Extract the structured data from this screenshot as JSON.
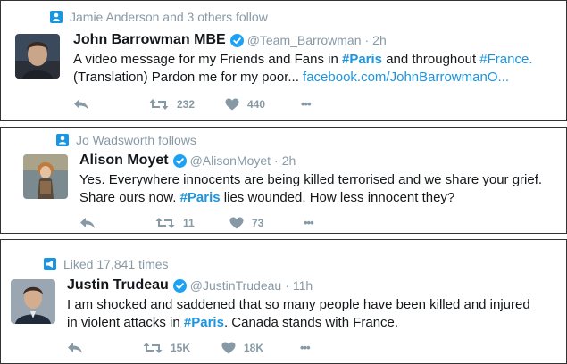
{
  "tweets": [
    {
      "context": "Jamie Anderson and 3 others follow",
      "name": "John Barrowman MBE",
      "handle": "@Team_Barrowman",
      "time": "2h",
      "line1": {
        "a": "A video message for my Friends and Fans in ",
        "b": "#Paris",
        "c": " and throughout ",
        "d": "#France."
      },
      "line2": {
        "a": "(Translation) Pardon me for my poor... ",
        "b": "facebook.com/JohnBarrowmanO..."
      },
      "retweets": "232",
      "likes": "440"
    },
    {
      "context": "Jo Wadsworth follows",
      "name": "Alison Moyet",
      "handle": "@AlisonMoyet",
      "time": "2h",
      "line1": "Yes. Everywhere innocents are being killed terrorised and we share your grief.",
      "line2": {
        "a": "Share ours now. ",
        "b": "#Paris",
        "c": " lies wounded. How less innocent they?"
      },
      "retweets": "11",
      "likes": "73"
    },
    {
      "context": "Liked 17,841 times",
      "name": "Justin Trudeau",
      "handle": "@JustinTrudeau",
      "time": "11h",
      "line1": "I am shocked and saddened that so many people have been killed and injured",
      "line2": {
        "a": "in violent attacks in ",
        "b": "#Paris",
        "c": ". Canada stands with France."
      },
      "retweets": "15K",
      "likes": "18K"
    }
  ],
  "separator": "·",
  "more_label": "•••",
  "icons": {
    "follow_context": "person-icon",
    "like_context": "megaphone-icon",
    "verified": "verified-badge-icon",
    "reply": "reply-icon",
    "retweet": "retweet-icon",
    "like": "heart-icon",
    "more": "more-icon"
  },
  "colors": {
    "accent": "#1b95e0",
    "muted": "#8899a6",
    "text": "#14171a",
    "verified": "#1da1f2"
  }
}
